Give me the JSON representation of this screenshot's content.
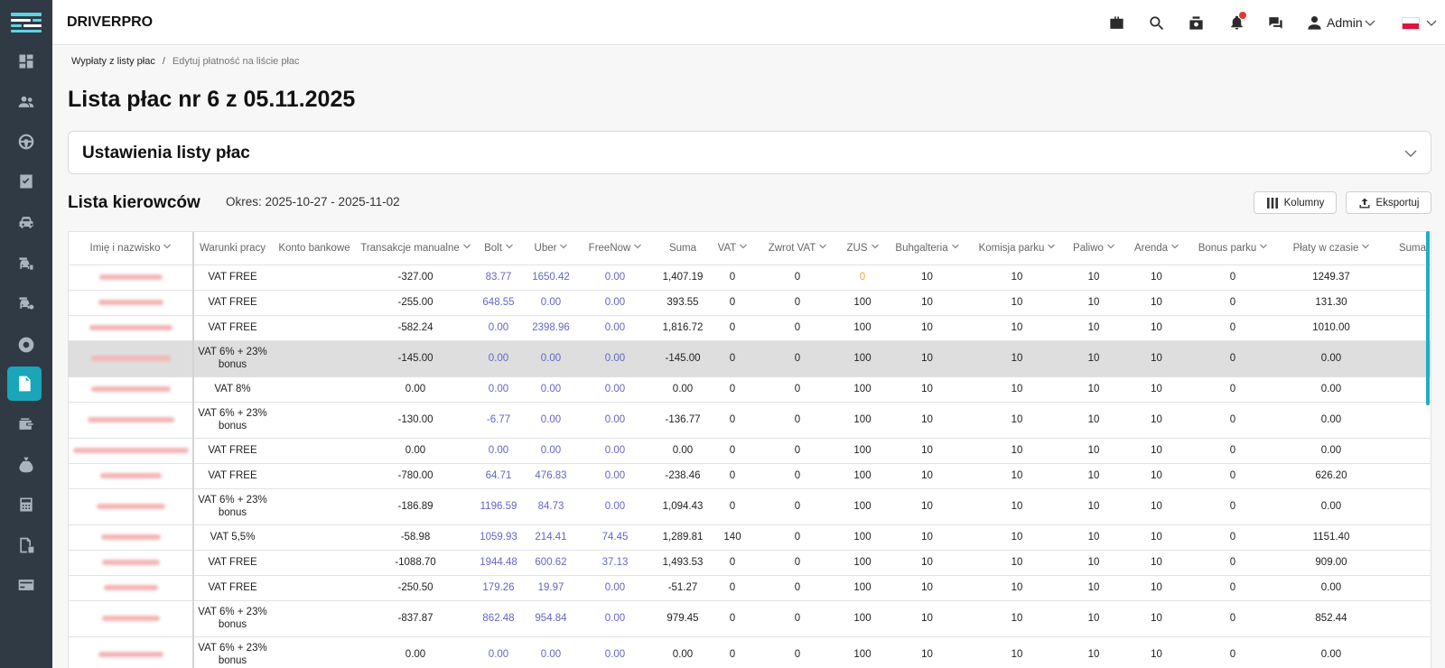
{
  "app": {
    "brand": "DRIVERPRO"
  },
  "colors": {
    "sidebar_bg": "#2f3a45",
    "accent": "#1aa5b8",
    "link": "#6366c7",
    "highlight_row": "#dedede",
    "warning": "#f0a030"
  },
  "sidebar": {
    "items": [
      {
        "icon": "dashboard-icon",
        "active": false
      },
      {
        "icon": "users-icon",
        "active": false
      },
      {
        "icon": "steering-wheel-icon",
        "active": false
      },
      {
        "icon": "checklist-icon",
        "active": false
      },
      {
        "icon": "car-icon",
        "active": false
      },
      {
        "icon": "car-rental-icon",
        "active": false
      },
      {
        "icon": "car-settings-icon",
        "active": false
      },
      {
        "icon": "tire-icon",
        "active": false
      },
      {
        "icon": "payroll-document-icon",
        "active": true
      },
      {
        "icon": "wallet-icon",
        "active": false
      },
      {
        "icon": "money-bag-icon",
        "active": false
      },
      {
        "icon": "calculator-icon",
        "active": false
      },
      {
        "icon": "document-money-icon",
        "active": false
      },
      {
        "icon": "credit-card-icon",
        "active": false
      }
    ]
  },
  "topbar": {
    "icons": [
      "briefcase-icon",
      "search-icon",
      "money-icon",
      "bell-icon",
      "chat-icon"
    ],
    "user_name": "Admin",
    "language_flag": "flag-pl-icon"
  },
  "breadcrumb": {
    "first": "Wypłaty z listy płac",
    "separator": "/",
    "current": "Edytuj płatność na liście płac"
  },
  "page_title": "Lista płac nr 6 z 05.11.2025",
  "settings_section": {
    "title": "Ustawienia listy płac"
  },
  "drivers_section": {
    "title": "Lista kierowców",
    "period": "Okres: 2025-10-27 - 2025-11-02",
    "columns_button": "Kolumny",
    "export_button": "Eksportuj"
  },
  "table": {
    "columns": [
      {
        "label": "Imię i nazwisko",
        "sortable": true
      },
      {
        "label": "Warunki pracy",
        "sortable": false
      },
      {
        "label": "Konto bankowe",
        "sortable": false
      },
      {
        "label": "Transakcje manualne",
        "sortable": true
      },
      {
        "label": "Bolt",
        "sortable": true
      },
      {
        "label": "Uber",
        "sortable": true
      },
      {
        "label": "FreeNow",
        "sortable": true
      },
      {
        "label": "Suma",
        "sortable": false
      },
      {
        "label": "VAT",
        "sortable": true
      },
      {
        "label": "Zwrot VAT",
        "sortable": true
      },
      {
        "label": "ZUS",
        "sortable": true
      },
      {
        "label": "Buhgalteria",
        "sortable": true
      },
      {
        "label": "Komisja parku",
        "sortable": true
      },
      {
        "label": "Paliwo",
        "sortable": true
      },
      {
        "label": "Arenda",
        "sortable": true
      },
      {
        "label": "Bonus parku",
        "sortable": true
      },
      {
        "label": "Płaty w czasie",
        "sortable": true
      },
      {
        "label": "Suma",
        "sortable": false
      }
    ],
    "rows": [
      {
        "conditions": "VAT FREE",
        "bank": "",
        "manual": "-327.00",
        "bolt": "83.77",
        "uber": "1650.42",
        "freenow": "0.00",
        "sum": "1,407.19",
        "vat": "0",
        "vat_return": "0",
        "zus": "0",
        "accounting": "10",
        "park_commission": "10",
        "fuel": "10",
        "rent": "10",
        "park_bonus": "0",
        "payments_over_time": "1249.37",
        "zus_warning": true
      },
      {
        "conditions": "VAT FREE",
        "bank": "",
        "manual": "-255.00",
        "bolt": "648.55",
        "uber": "0.00",
        "freenow": "0.00",
        "sum": "393.55",
        "vat": "0",
        "vat_return": "0",
        "zus": "100",
        "accounting": "10",
        "park_commission": "10",
        "fuel": "10",
        "rent": "10",
        "park_bonus": "0",
        "payments_over_time": "131.30"
      },
      {
        "conditions": "VAT FREE",
        "bank": "",
        "manual": "-582.24",
        "bolt": "0.00",
        "uber": "2398.96",
        "freenow": "0.00",
        "sum": "1,816.72",
        "vat": "0",
        "vat_return": "0",
        "zus": "100",
        "accounting": "10",
        "park_commission": "10",
        "fuel": "10",
        "rent": "10",
        "park_bonus": "0",
        "payments_over_time": "1010.00"
      },
      {
        "conditions": "VAT 6% + 23% bonus",
        "bank": "",
        "manual": "-145.00",
        "bolt": "0.00",
        "uber": "0.00",
        "freenow": "0.00",
        "sum": "-145.00",
        "vat": "0",
        "vat_return": "0",
        "zus": "100",
        "accounting": "10",
        "park_commission": "10",
        "fuel": "10",
        "rent": "10",
        "park_bonus": "0",
        "payments_over_time": "0.00",
        "highlighted": true
      },
      {
        "conditions": "VAT 8%",
        "bank": "",
        "manual": "0.00",
        "bolt": "0.00",
        "uber": "0.00",
        "freenow": "0.00",
        "sum": "0.00",
        "vat": "0",
        "vat_return": "0",
        "zus": "100",
        "accounting": "10",
        "park_commission": "10",
        "fuel": "10",
        "rent": "10",
        "park_bonus": "0",
        "payments_over_time": "0.00"
      },
      {
        "conditions": "VAT 6% + 23% bonus",
        "bank": "",
        "manual": "-130.00",
        "bolt": "-6.77",
        "uber": "0.00",
        "freenow": "0.00",
        "sum": "-136.77",
        "vat": "0",
        "vat_return": "0",
        "zus": "100",
        "accounting": "10",
        "park_commission": "10",
        "fuel": "10",
        "rent": "10",
        "park_bonus": "0",
        "payments_over_time": "0.00"
      },
      {
        "conditions": "VAT FREE",
        "bank": "",
        "manual": "0.00",
        "bolt": "0.00",
        "uber": "0.00",
        "freenow": "0.00",
        "sum": "0.00",
        "vat": "0",
        "vat_return": "0",
        "zus": "100",
        "accounting": "10",
        "park_commission": "10",
        "fuel": "10",
        "rent": "10",
        "park_bonus": "0",
        "payments_over_time": "0.00"
      },
      {
        "conditions": "VAT FREE",
        "bank": "",
        "manual": "-780.00",
        "bolt": "64.71",
        "uber": "476.83",
        "freenow": "0.00",
        "sum": "-238.46",
        "vat": "0",
        "vat_return": "0",
        "zus": "100",
        "accounting": "10",
        "park_commission": "10",
        "fuel": "10",
        "rent": "10",
        "park_bonus": "0",
        "payments_over_time": "626.20"
      },
      {
        "conditions": "VAT 6% + 23% bonus",
        "bank": "",
        "manual": "-186.89",
        "bolt": "1196.59",
        "uber": "84.73",
        "freenow": "0.00",
        "sum": "1,094.43",
        "vat": "0",
        "vat_return": "0",
        "zus": "100",
        "accounting": "10",
        "park_commission": "10",
        "fuel": "10",
        "rent": "10",
        "park_bonus": "0",
        "payments_over_time": "0.00"
      },
      {
        "conditions": "VAT 5,5%",
        "bank": "",
        "manual": "-58.98",
        "bolt": "1059.93",
        "uber": "214.41",
        "freenow": "74.45",
        "sum": "1,289.81",
        "vat": "140",
        "vat_return": "0",
        "zus": "100",
        "accounting": "10",
        "park_commission": "10",
        "fuel": "10",
        "rent": "10",
        "park_bonus": "0",
        "payments_over_time": "1151.40"
      },
      {
        "conditions": "VAT FREE",
        "bank": "",
        "manual": "-1088.70",
        "bolt": "1944.48",
        "uber": "600.62",
        "freenow": "37.13",
        "sum": "1,493.53",
        "vat": "0",
        "vat_return": "0",
        "zus": "100",
        "accounting": "10",
        "park_commission": "10",
        "fuel": "10",
        "rent": "10",
        "park_bonus": "0",
        "payments_over_time": "909.00"
      },
      {
        "conditions": "VAT FREE",
        "bank": "",
        "manual": "-250.50",
        "bolt": "179.26",
        "uber": "19.97",
        "freenow": "0.00",
        "sum": "-51.27",
        "vat": "0",
        "vat_return": "0",
        "zus": "100",
        "accounting": "10",
        "park_commission": "10",
        "fuel": "10",
        "rent": "10",
        "park_bonus": "0",
        "payments_over_time": "0.00"
      },
      {
        "conditions": "VAT 6% + 23% bonus",
        "bank": "",
        "manual": "-837.87",
        "bolt": "862.48",
        "uber": "954.84",
        "freenow": "0.00",
        "sum": "979.45",
        "vat": "0",
        "vat_return": "0",
        "zus": "100",
        "accounting": "10",
        "park_commission": "10",
        "fuel": "10",
        "rent": "10",
        "park_bonus": "0",
        "payments_over_time": "852.44"
      },
      {
        "conditions": "VAT 6% + 23% bonus",
        "bank": "",
        "manual": "0.00",
        "bolt": "0.00",
        "uber": "0.00",
        "freenow": "0.00",
        "sum": "0.00",
        "vat": "0",
        "vat_return": "0",
        "zus": "100",
        "accounting": "10",
        "park_commission": "10",
        "fuel": "10",
        "rent": "10",
        "park_bonus": "0",
        "payments_over_time": "0.00"
      }
    ]
  }
}
